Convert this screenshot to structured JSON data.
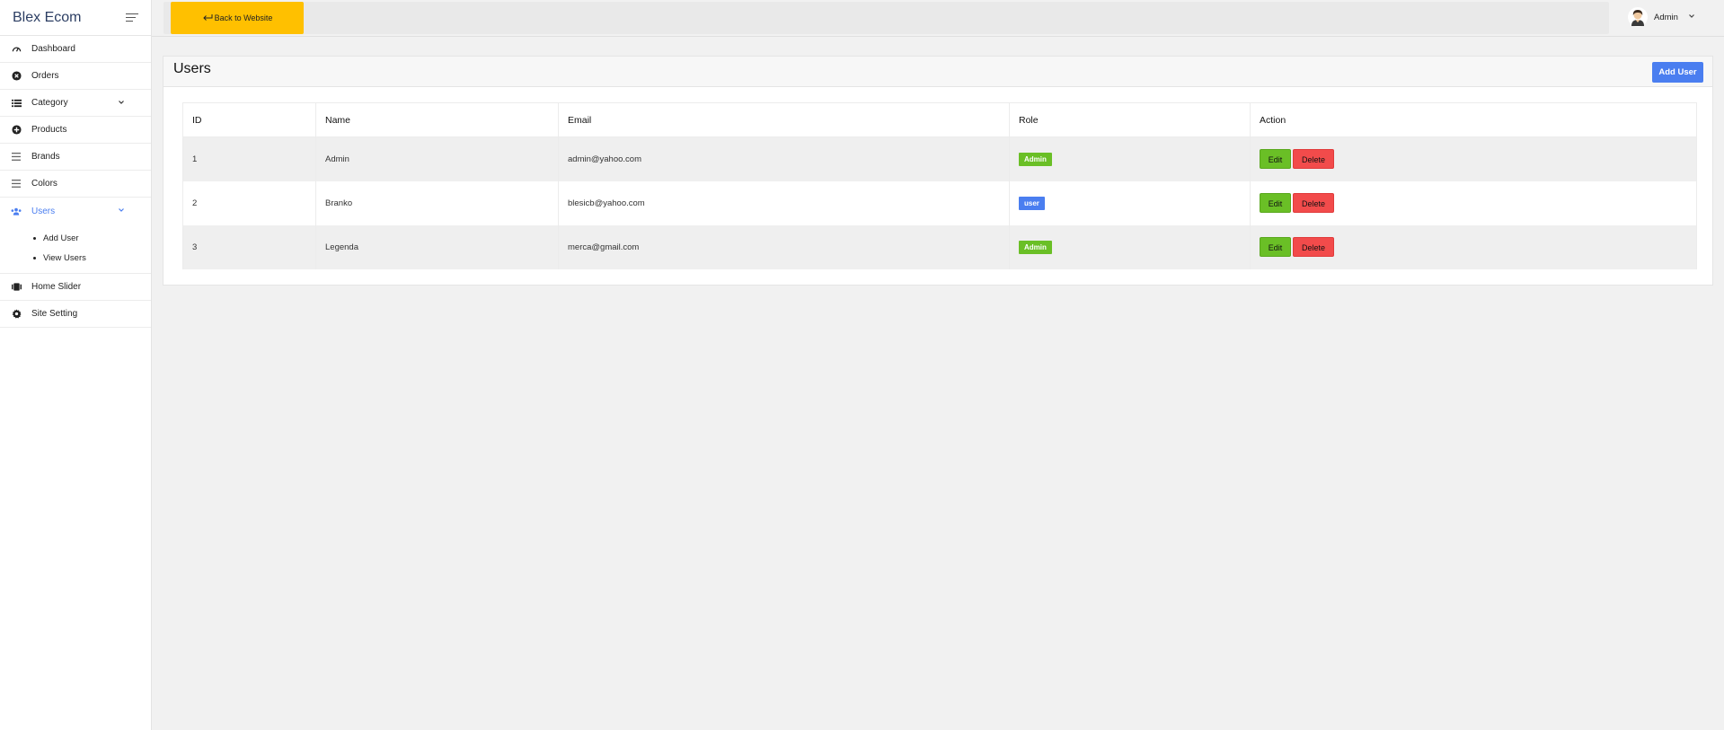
{
  "app": {
    "brand": "Blex Ecom"
  },
  "sidebar": {
    "items": [
      {
        "label": "Dashboard",
        "icon": "gauge-icon"
      },
      {
        "label": "Orders",
        "icon": "orders-icon"
      },
      {
        "label": "Category",
        "icon": "list-icon",
        "has_caret": true
      },
      {
        "label": "Products",
        "icon": "plus-circle-icon"
      },
      {
        "label": "Brands",
        "icon": "lines-icon"
      },
      {
        "label": "Colors",
        "icon": "lines-icon"
      },
      {
        "label": "Users",
        "icon": "users-icon",
        "has_caret": true,
        "active": true
      },
      {
        "label": "Home Slider",
        "icon": "slider-icon"
      },
      {
        "label": "Site Setting",
        "icon": "gear-icon"
      }
    ],
    "users_sub": [
      "Add User",
      "View Users"
    ]
  },
  "topbar": {
    "back_label": "Back to Website",
    "user_name": "Admin"
  },
  "page": {
    "title": "Users",
    "add_button": "Add User"
  },
  "table": {
    "columns": [
      "ID",
      "Name",
      "Email",
      "Role",
      "Action"
    ],
    "rows": [
      {
        "id": "1",
        "name": "Admin",
        "email": "admin@yahoo.com",
        "role": "Admin"
      },
      {
        "id": "2",
        "name": "Branko",
        "email": "blesicb@yahoo.com",
        "role": "user"
      },
      {
        "id": "3",
        "name": "Legenda",
        "email": "merca@gmail.com",
        "role": "Admin"
      }
    ],
    "edit_label": "Edit",
    "delete_label": "Delete"
  },
  "colors": {
    "accent": "#4a7ef0",
    "back_button": "#ffc000",
    "edit": "#6abf26",
    "delete": "#f24b4b"
  }
}
